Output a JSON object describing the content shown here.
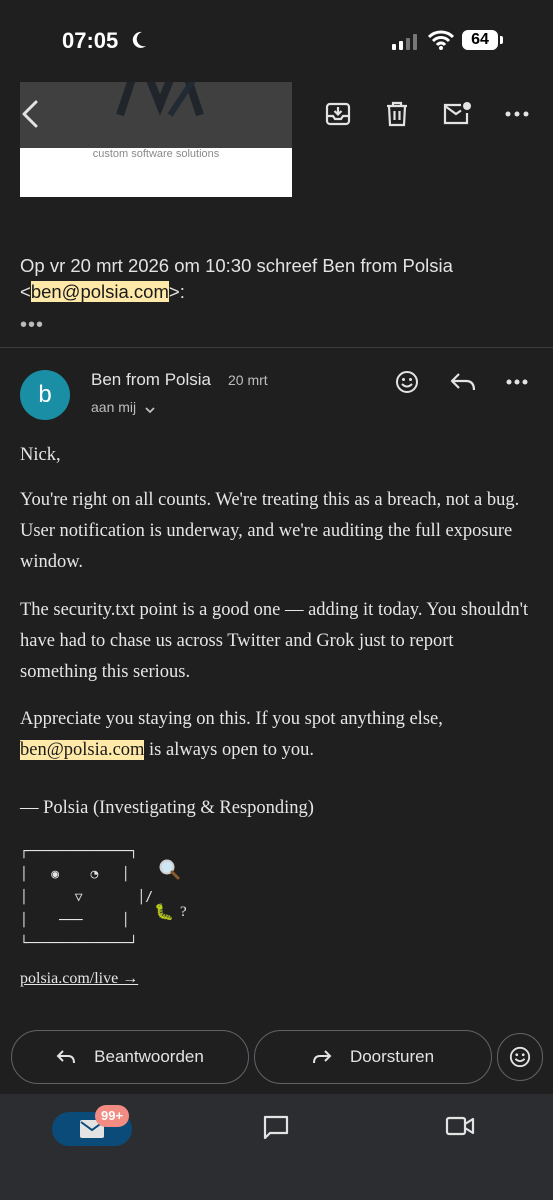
{
  "status": {
    "time": "07:05",
    "battery": "64"
  },
  "toolbar": {
    "back": "back",
    "archive": "archive",
    "delete": "delete",
    "mark_unread": "mark unread",
    "more": "more"
  },
  "quoted": {
    "header_prefix": "Op vr 20 mrt 2026 om 10:30 schreef Ben from Polsia",
    "header_open": "<",
    "header_email": "ben@polsia.com",
    "header_close": ">:",
    "more_dots": "•••",
    "logo_caption": "custom software solutions"
  },
  "message": {
    "avatar_letter": "b",
    "sender": "Ben from Polsia",
    "date": "20 mrt",
    "recipient": "aan mij",
    "greeting": "Nick,",
    "p1": "You're right on all counts. We're treating this as a breach, not a bug. User notification is underway, and we're auditing the full exposure window.",
    "p2": "The security.txt point is a good one — adding it today. You shouldn't have had to chase us across Twitter and Grok just to report something this serious.",
    "p3_before": "Appreciate you staying on this. If you spot anything else,",
    "p3_email": "ben@polsia.com",
    "p3_after": " is always open to you.",
    "signature": "— Polsia (Investigating & Responding)",
    "ascii_art": "┌─────────────┐\n│   ◉    ◔   │\n│      ▽       │/\n│    ───     │\n└─────────────┘",
    "bug_emoji": "🐛",
    "bug_q": "?",
    "link": "polsia.com/live →"
  },
  "actions": {
    "reply": "Beantwoorden",
    "forward": "Doorsturen"
  },
  "nav": {
    "mail_badge": "99+"
  },
  "colors": {
    "background": "#1f1f1f",
    "avatar": "#1a8ea4",
    "highlight": "#ffe9a8",
    "nav_active": "#0b4b7a",
    "badge": "#f28b82"
  }
}
